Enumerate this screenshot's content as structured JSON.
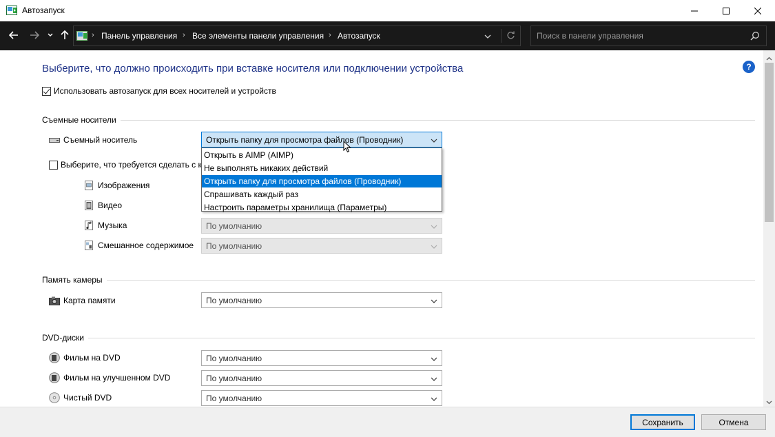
{
  "window": {
    "title": "Автозапуск",
    "accent": "#0078d7"
  },
  "address": {
    "crumbs": [
      "Панель управления",
      "Все элементы панели управления",
      "Автозапуск"
    ]
  },
  "search": {
    "placeholder": "Поиск в панели управления"
  },
  "heading": "Выберите, что должно происходить при вставке носителя или подключении устройства",
  "autoplay_all": {
    "label": "Использовать автозапуск для всех носителей и устройств",
    "checked": true
  },
  "sections": {
    "removable": {
      "title": "Съемные носители",
      "device_label": "Съемный носитель",
      "device_value": "Открыть папку для просмотра файлов (Проводник)",
      "choose_label": "Выберите, что требуется сделать с ка",
      "images_label": "Изображения",
      "video_label": "Видео",
      "music_label": "Музыка",
      "music_value": "По умолчанию",
      "mixed_label": "Смешанное содержимое",
      "mixed_value": "По умолчанию"
    },
    "camera": {
      "title": "Память камеры",
      "card_label": "Карта памяти",
      "card_value": "По умолчанию"
    },
    "dvd": {
      "title": "DVD-диски",
      "movie_label": "Фильм на DVD",
      "movie_value": "По умолчанию",
      "enhanced_label": "Фильм на улучшенном DVD",
      "enhanced_value": "По умолчанию",
      "blank_label": "Чистый DVD",
      "blank_value": "По умолчанию"
    }
  },
  "dropdown": {
    "options": [
      "Открыть в AIMP (AIMP)",
      "Не выполнять никаких действий",
      "Открыть папку для просмотра файлов (Проводник)",
      "Спрашивать каждый раз",
      "Настроить параметры хранилища (Параметры)"
    ],
    "selected_index": 2
  },
  "footer": {
    "save_label": "Сохранить",
    "cancel_label": "Отмена"
  },
  "help_label": "?"
}
